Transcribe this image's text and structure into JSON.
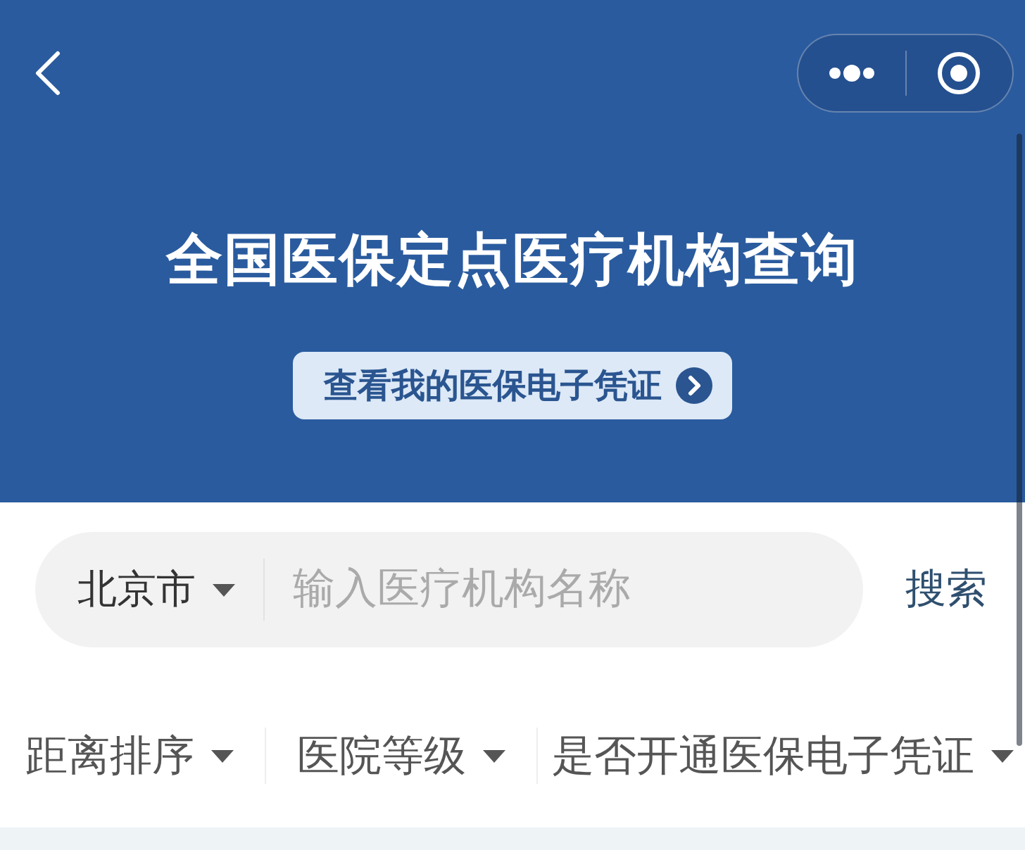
{
  "header": {
    "title": "全国医保定点医疗机构查询",
    "voucher_button": "查看我的医保电子凭证"
  },
  "search": {
    "city": "北京市",
    "placeholder": "输入医疗机构名称",
    "button": "搜索"
  },
  "filters": [
    {
      "label": "距离排序"
    },
    {
      "label": "医院等级"
    },
    {
      "label": "是否开通医保电子凭证"
    }
  ]
}
